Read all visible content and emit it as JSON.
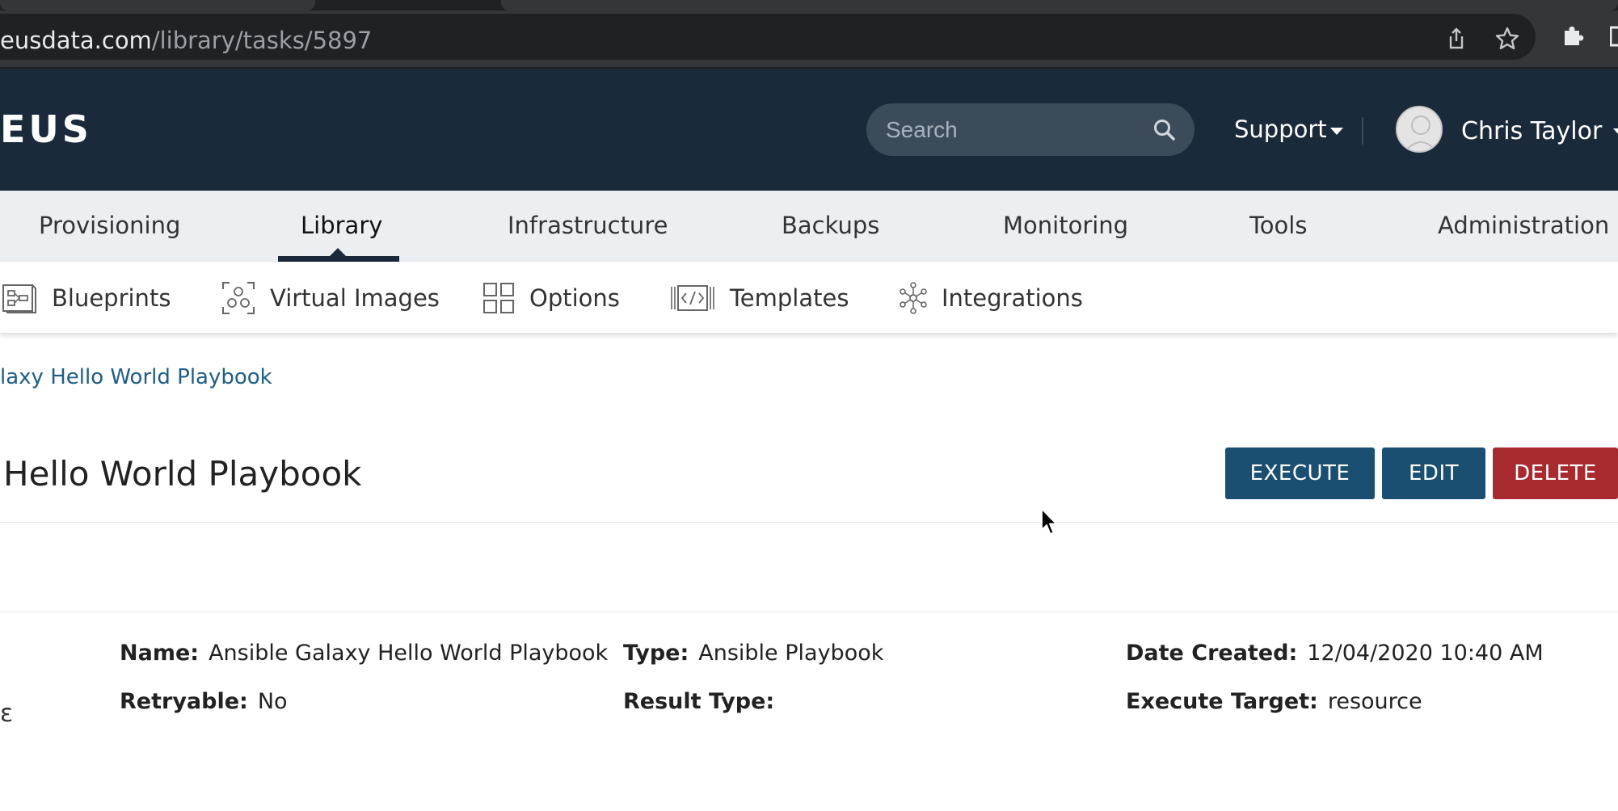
{
  "browser": {
    "url_host": "eusdata.com",
    "url_path": "/library/tasks/5897"
  },
  "header": {
    "logo": "EUS",
    "search_placeholder": "Search",
    "support_label": "Support",
    "user_name": "Chris Taylor"
  },
  "primary_nav": {
    "items": [
      {
        "label": "Provisioning"
      },
      {
        "label": "Library"
      },
      {
        "label": "Infrastructure"
      },
      {
        "label": "Backups"
      },
      {
        "label": "Monitoring"
      },
      {
        "label": "Tools"
      },
      {
        "label": "Administration"
      }
    ],
    "active": "Library"
  },
  "sub_nav": {
    "items": [
      {
        "label": "Blueprints",
        "icon": "blueprints-icon"
      },
      {
        "label": "Virtual Images",
        "icon": "virtual-images-icon"
      },
      {
        "label": "Options",
        "icon": "options-icon"
      },
      {
        "label": "Templates",
        "icon": "templates-icon"
      },
      {
        "label": "Integrations",
        "icon": "integrations-icon"
      }
    ]
  },
  "breadcrumb": "laxy Hello World Playbook",
  "page": {
    "title": "Hello World Playbook",
    "actions": {
      "execute": "EXECUTE",
      "edit": "EDIT",
      "delete": "DELETE"
    }
  },
  "details": {
    "name": {
      "label": "Name:",
      "value": "Ansible Galaxy Hello World Playbook"
    },
    "type": {
      "label": "Type:",
      "value": "Ansible Playbook"
    },
    "date_created": {
      "label": "Date Created:",
      "value": "12/04/2020 10:40 AM"
    },
    "retryable": {
      "label": "Retryable:",
      "value": "No"
    },
    "result_type": {
      "label": "Result Type:",
      "value": ""
    },
    "execute_target": {
      "label": "Execute Target:",
      "value": "resource"
    },
    "edge_glyph": "ε"
  },
  "colors": {
    "header_bg": "#1b2a3a",
    "nav_bg": "#eceff2",
    "primary_button": "#1b4f72",
    "danger_button": "#a82a2f",
    "link": "#1f5d85"
  }
}
